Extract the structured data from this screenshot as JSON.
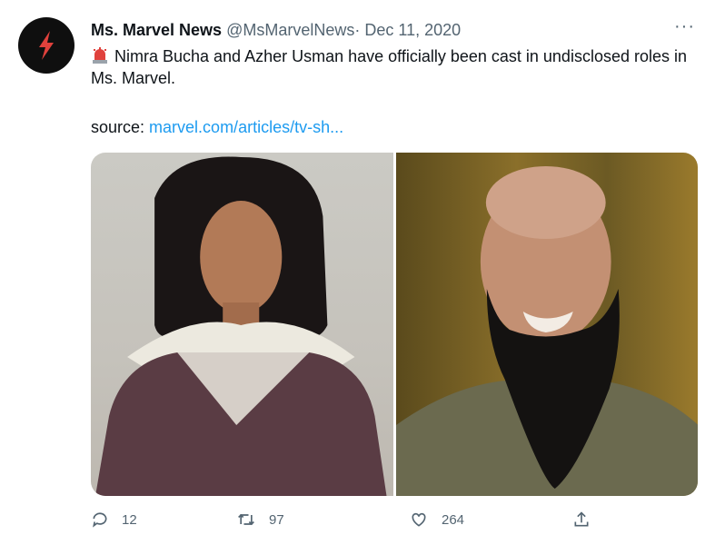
{
  "tweet": {
    "author_name": "Ms. Marvel News",
    "handle": "@MsMarvelNews",
    "separator": "·",
    "date": "Dec 11, 2020",
    "more": "···",
    "text": "Nimra Bucha and Azher Usman have officially been cast in undisclosed roles in Ms. Marvel.",
    "source_label": "source:",
    "source_link": "marvel.com/articles/tv-sh..."
  },
  "media": [
    {
      "alt": "Woman with long black hair, white scarf and patterned top"
    },
    {
      "alt": "Smiling bald man with long black beard in olive shirt"
    }
  ],
  "actions": {
    "reply_count": "12",
    "retweet_count": "97",
    "like_count": "264"
  },
  "colors": {
    "link": "#1d9bf0",
    "muted": "#536471",
    "avatar_bg": "#0f0f0f",
    "avatar_bolt": "#e0413c"
  },
  "icons": [
    "lightning-icon",
    "siren-icon",
    "more-icon",
    "reply-icon",
    "retweet-icon",
    "like-icon",
    "share-icon"
  ]
}
